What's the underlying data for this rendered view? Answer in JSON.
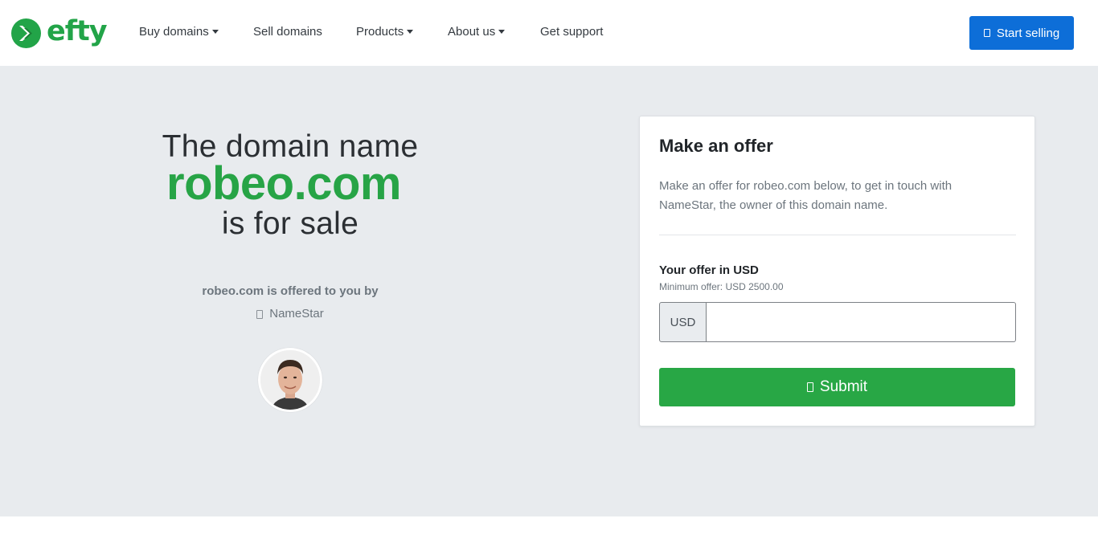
{
  "brand": {
    "name": "efty",
    "color": "#22a448"
  },
  "nav": {
    "items": [
      {
        "label": "Buy domains",
        "has_dropdown": true
      },
      {
        "label": "Sell domains",
        "has_dropdown": false
      },
      {
        "label": "Products",
        "has_dropdown": true
      },
      {
        "label": "About us",
        "has_dropdown": true
      },
      {
        "label": "Get support",
        "has_dropdown": false
      }
    ],
    "cta": {
      "label": "Start selling",
      "icon": "store-icon",
      "color": "#0d6ed8"
    }
  },
  "hero": {
    "line1": "The domain name",
    "domain": "robeo.com",
    "line2": "is for sale",
    "offered_by": "robeo.com is offered to you by",
    "owner": {
      "name": "NameStar",
      "icon": "user-icon"
    },
    "domain_color": "#27a446"
  },
  "offer": {
    "title": "Make an offer",
    "description": "Make an offer for robeo.com below, to get in touch with NameStar, the owner of this domain name.",
    "label": "Your offer in USD",
    "minimum": "Minimum offer: USD 2500.00",
    "currency_prefix": "USD",
    "value": "",
    "submit_label": "Submit",
    "submit_icon": "send-icon",
    "submit_color": "#28a745"
  }
}
